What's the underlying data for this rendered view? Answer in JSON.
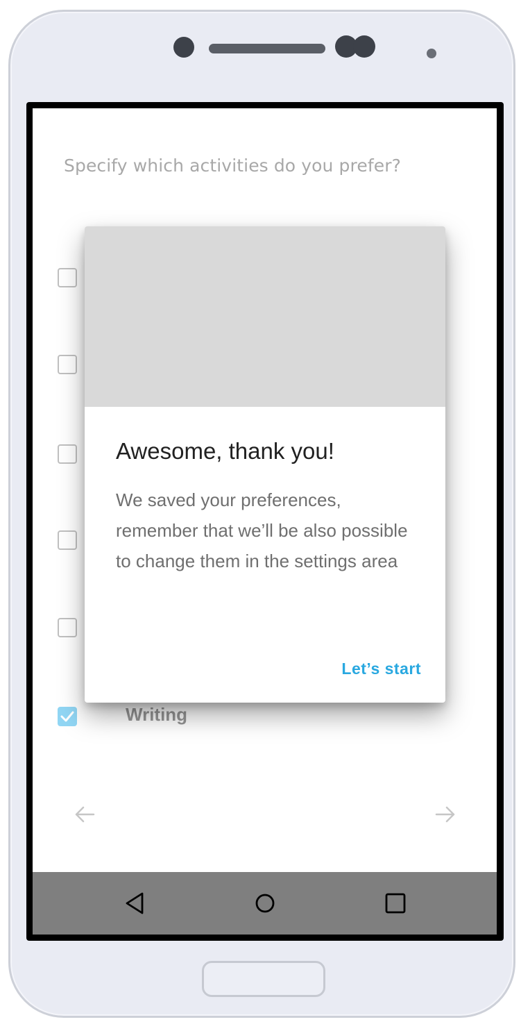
{
  "screen": {
    "question": "Specify which activities do you prefer?",
    "options": [
      {
        "label": "",
        "checked": false
      },
      {
        "label": "",
        "checked": false
      },
      {
        "label": "",
        "checked": false
      },
      {
        "label": "",
        "checked": false
      },
      {
        "label": "",
        "checked": false
      },
      {
        "label": "Writing",
        "checked": true
      }
    ],
    "nav": {
      "back_icon": "arrow-left-icon",
      "next_icon": "arrow-right-icon"
    }
  },
  "dialog": {
    "title": "Awesome, thank you!",
    "body": "We saved your preferences, remember that we’ll be also possible to change them in the settings area",
    "action_label": "Let’s start"
  },
  "system_nav": {
    "back_icon": "triangle-back-icon",
    "home_icon": "circle-home-icon",
    "recents_icon": "square-recents-icon"
  },
  "colors": {
    "accent": "#29a8e0",
    "checkbox_checked": "#56c1ef",
    "navbar": "#7f7f7f",
    "dialog_image_placeholder": "#d9d9d9"
  }
}
